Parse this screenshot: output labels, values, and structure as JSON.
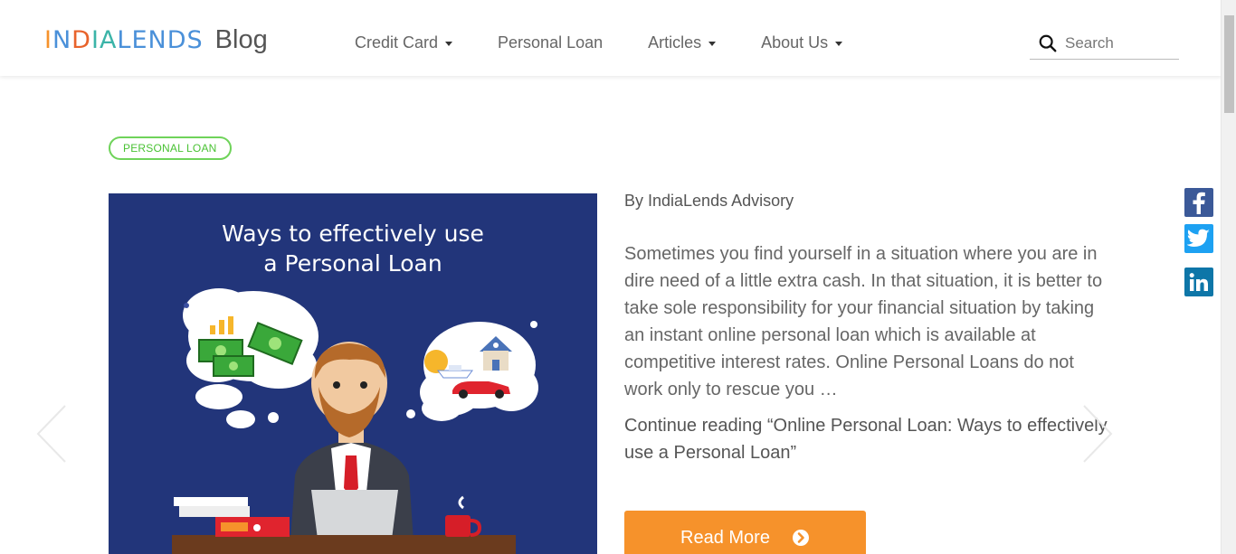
{
  "header": {
    "logo_text": "INDIALENDS",
    "blog_label": "Blog",
    "nav": [
      {
        "label": "Credit Card",
        "has_dropdown": true
      },
      {
        "label": "Personal Loan",
        "has_dropdown": false
      },
      {
        "label": "Articles",
        "has_dropdown": true
      },
      {
        "label": "About Us",
        "has_dropdown": true
      }
    ],
    "search_placeholder": "Search"
  },
  "post": {
    "category_tag": "PERSONAL LOAN",
    "image_title_line1": "Ways to effectively use",
    "image_title_line2": "a Personal Loan",
    "author": "By IndiaLends Advisory",
    "excerpt": "Sometimes you find yourself in a situation where you are in dire need of a little extra cash. In that situation, it is better to take sole responsibility for your financial situation by taking an instant online personal loan which is available at competitive interest rates. Online Personal Loans do not work only to rescue you …",
    "continue_text": "Continue reading “Online Personal Loan: Ways to effectively use a Personal Loan”",
    "read_more_label": "Read More"
  },
  "social": [
    {
      "name": "facebook",
      "icon": "facebook-icon"
    },
    {
      "name": "twitter",
      "icon": "twitter-icon"
    },
    {
      "name": "linkedin",
      "icon": "linkedin-icon"
    }
  ],
  "colors": {
    "accent_orange": "#f6922b",
    "tag_green": "#4ac234",
    "hero_blue": "#22357a"
  }
}
